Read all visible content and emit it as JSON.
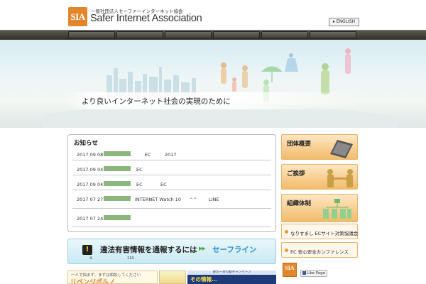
{
  "header": {
    "logo_mark": "SIA",
    "logo_sub": "一般社団法人セーファーインターネット協会",
    "logo_name": "Safer Internet Association",
    "english_label": "▸ ENGLISH"
  },
  "nav": {
    "item_count": 7
  },
  "hero": {
    "caption": "より良いインターネット社会の実現のために"
  },
  "news": {
    "title": "お知らせ",
    "items": [
      {
        "date": "2017 09 08",
        "text_a": "EC",
        "text_b": "2017"
      },
      {
        "date": "2017 09 04",
        "text_a": "EC",
        "text_b": ""
      },
      {
        "date": "2017 09 04",
        "text_a": "EC",
        "text_b": "EC"
      },
      {
        "date": "2017 07 27",
        "text_a": "INTERNET Watch 10",
        "text_b": "“  ”",
        "text_c": "LINE"
      },
      {
        "date": "2017 07 24",
        "text_a": "",
        "text_b": ""
      }
    ]
  },
  "hotline": {
    "icon": "!",
    "title": "違法有害情報を通報するには",
    "arrows": "▶▶",
    "link": "セーフライン",
    "sub1": "※",
    "sub2": "110"
  },
  "ads": {
    "ad1_text": "一人で悩まず、まずは相談してください",
    "ad1_big": "リベンジポルノ",
    "ad3_top": "春の一斉行動キャンペーン",
    "ad3_text": "その情報…"
  },
  "side": {
    "cards": [
      "団体概要",
      "ご挨拶",
      "組織体制"
    ],
    "links": [
      "なりすまし ECサイト対策協議会",
      "EC 安心安全カンファレンス"
    ]
  },
  "footer": {
    "badge": "SIA",
    "like": "Like Page"
  },
  "colors": {
    "accent": "#e2862d",
    "nav": "#3c3c34",
    "hotline_link": "#2a8fc6"
  }
}
